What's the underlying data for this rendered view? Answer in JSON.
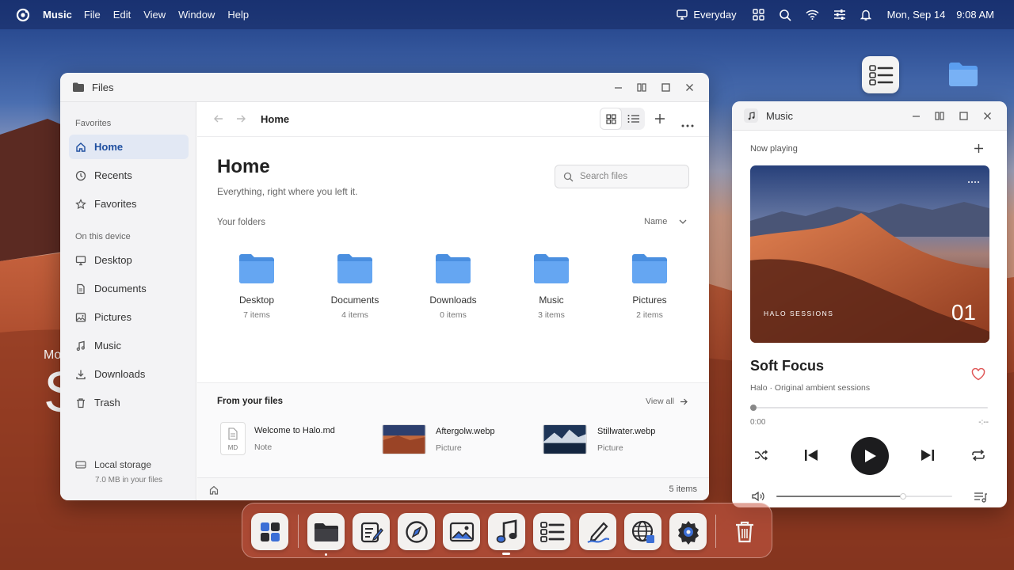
{
  "menubar": {
    "app_name": "Music",
    "menus": [
      "File",
      "Edit",
      "View",
      "Window",
      "Help"
    ],
    "workspace": "Everyday",
    "date": "Mon, Sep 14",
    "time": "9:08 AM"
  },
  "desktop": {
    "partial_text_1": "Mo",
    "partial_text_2": "S"
  },
  "files": {
    "title": "Files",
    "breadcrumb": "Home",
    "sidebar": {
      "favorites_heading": "Favorites",
      "favorites": [
        {
          "label": "Home",
          "icon": "home-icon",
          "active": true
        },
        {
          "label": "Recents",
          "icon": "clock-icon",
          "active": false
        },
        {
          "label": "Favorites",
          "icon": "star-icon",
          "active": false
        }
      ],
      "device_heading": "On this device",
      "device": [
        {
          "label": "Desktop",
          "icon": "monitor-icon"
        },
        {
          "label": "Documents",
          "icon": "document-icon"
        },
        {
          "label": "Pictures",
          "icon": "picture-icon"
        },
        {
          "label": "Music",
          "icon": "music-note-icon"
        },
        {
          "label": "Downloads",
          "icon": "download-icon"
        },
        {
          "label": "Trash",
          "icon": "trash-icon"
        }
      ],
      "storage_label": "Local storage",
      "storage_detail": "7.0 MB in your files"
    },
    "heading": "Home",
    "subheading": "Everything, right where you left it.",
    "search_placeholder": "Search files",
    "folders_heading": "Your folders",
    "sort_label": "Name",
    "folders": [
      {
        "name": "Desktop",
        "count": "7 items"
      },
      {
        "name": "Documents",
        "count": "4 items"
      },
      {
        "name": "Downloads",
        "count": "0 items"
      },
      {
        "name": "Music",
        "count": "3 items"
      },
      {
        "name": "Pictures",
        "count": "2 items"
      }
    ],
    "recent_heading": "From your files",
    "view_all": "View all",
    "recent": [
      {
        "name": "Welcome to Halo.md",
        "type": "Note",
        "badge": "MD"
      },
      {
        "name": "Aftergolw.webp",
        "type": "Picture"
      },
      {
        "name": "Stillwater.webp",
        "type": "Picture"
      }
    ],
    "status_count": "5 items"
  },
  "music": {
    "title": "Music",
    "now_playing": "Now playing",
    "album_label": "HALO SESSIONS",
    "track_number": "01",
    "track_title": "Soft Focus",
    "track_subtitle": "Halo · Original ambient sessions",
    "elapsed": "0:00",
    "remaining": "-:--",
    "progress": 0.0,
    "volume": 0.72
  },
  "dock": {
    "apps": [
      "launcher-icon",
      "files-icon",
      "notes-icon",
      "compass-icon",
      "photos-icon",
      "music-icon",
      "tasks-icon",
      "draw-icon",
      "web-icon",
      "settings-icon",
      "trash-icon"
    ]
  },
  "colors": {
    "accent": "#1f4fa0",
    "folder": "#5b9ef0",
    "heart": "#e05a5a"
  }
}
